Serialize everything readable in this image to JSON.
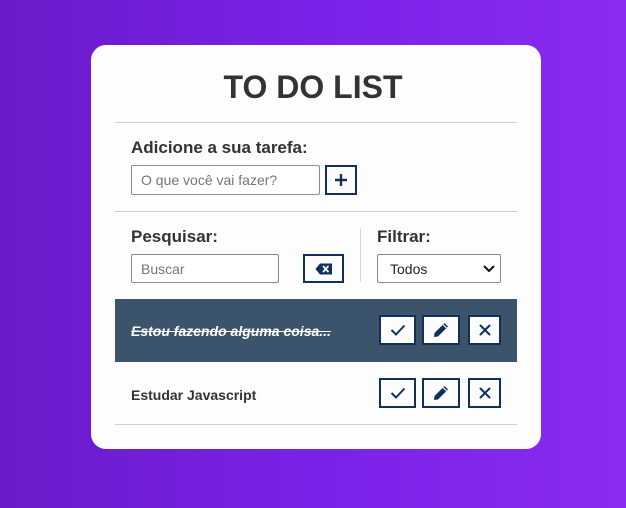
{
  "app": {
    "title": "TO DO LIST"
  },
  "add_form": {
    "label": "Adicione a sua tarefa:",
    "input_placeholder": "O que você vai fazer?",
    "input_value": "",
    "add_button_icon": "plus-icon"
  },
  "search": {
    "label": "Pesquisar:",
    "input_placeholder": "Buscar",
    "input_value": "",
    "clear_button_icon": "backspace-icon"
  },
  "filter": {
    "label": "Filtrar:",
    "selected": "Todos"
  },
  "todos": [
    {
      "text": "Estou fazendo alguma coisa...",
      "done": true,
      "actions": [
        "check-icon",
        "pencil-icon",
        "close-icon"
      ]
    },
    {
      "text": "Estudar Javascript",
      "done": false,
      "actions": [
        "check-icon",
        "pencil-icon",
        "close-icon"
      ]
    }
  ],
  "colors": {
    "background_start": "#6a1bc9",
    "background_end": "#8a2bf0",
    "card": "#fdfdfd",
    "accent": "#12305c",
    "done_row": "#3c546b",
    "text": "#333333"
  }
}
